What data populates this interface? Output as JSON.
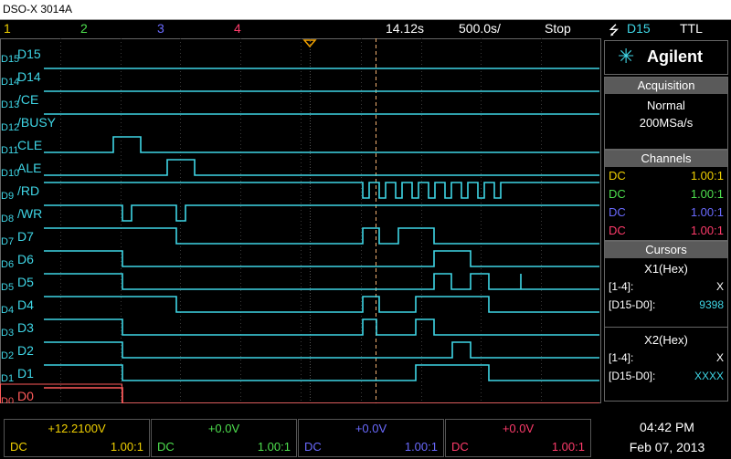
{
  "window": {
    "title": "DSO-X 3014A"
  },
  "topbar": {
    "ch1": "1",
    "ch2": "2",
    "ch3": "3",
    "ch4": "4",
    "time": "14.12s",
    "timebase": "500.0s/",
    "status": "Stop",
    "trigger_source": "D15",
    "logic": "TTL"
  },
  "colors": {
    "ch1": "#f0d000",
    "ch2": "#4ee04e",
    "ch3": "#6a6aff",
    "ch4": "#ff3b6b",
    "digital": "#3fd6e6",
    "d0": "#ff5a5a",
    "dark_bg": "#000000",
    "header_bg": "#5a5a5a"
  },
  "brand": {
    "name": "Agilent"
  },
  "acquisition": {
    "header": "Acquisition",
    "mode": "Normal",
    "rate": "200MSa/s"
  },
  "channels": {
    "header": "Channels",
    "rows": [
      {
        "coupling": "DC",
        "scale": "1.00:1"
      },
      {
        "coupling": "DC",
        "scale": "1.00:1"
      },
      {
        "coupling": "DC",
        "scale": "1.00:1"
      },
      {
        "coupling": "DC",
        "scale": "1.00:1"
      }
    ]
  },
  "cursors": {
    "header": "Cursors",
    "x1": {
      "title": "X1(Hex)",
      "row1_label": "[1-4]:",
      "row1_value": "X",
      "row2_label": "[D15-D0]:",
      "row2_value": "9398"
    },
    "x2": {
      "title": "X2(Hex)",
      "row1_label": "[1-4]:",
      "row1_value": "X",
      "row2_label": "[D15-D0]:",
      "row2_value": "XXXX"
    }
  },
  "bottom": {
    "ch": [
      {
        "value": "+12.2100V",
        "coupling": "DC",
        "scale": "1.00:1"
      },
      {
        "value": "+0.0V",
        "coupling": "DC",
        "scale": "1.00:1"
      },
      {
        "value": "+0.0V",
        "coupling": "DC",
        "scale": "1.00:1"
      },
      {
        "value": "+0.0V",
        "coupling": "DC",
        "scale": "1.00:1"
      }
    ],
    "time": "04:42 PM",
    "date": "Feb 07, 2013"
  },
  "traces": [
    {
      "id": "D15",
      "label": "D15",
      "level": "none"
    },
    {
      "id": "D14",
      "label": "D14",
      "level": "high"
    },
    {
      "id": "D13",
      "label": "/CE",
      "level": "high"
    },
    {
      "id": "D12",
      "label": "/BUSY",
      "level": "high"
    },
    {
      "id": "D11",
      "label": "CLE",
      "level": "low"
    },
    {
      "id": "D10",
      "label": "ALE",
      "level": "low"
    },
    {
      "id": "D9",
      "label": "/RD",
      "level": "high"
    },
    {
      "id": "D8",
      "label": "/WR",
      "level": "high"
    },
    {
      "id": "D7",
      "label": "D7",
      "level": "mixed"
    },
    {
      "id": "D6",
      "label": "D6",
      "level": "mixed"
    },
    {
      "id": "D5",
      "label": "D5",
      "level": "mixed"
    },
    {
      "id": "D4",
      "label": "D4",
      "level": "mixed"
    },
    {
      "id": "D3",
      "label": "D3",
      "level": "mixed"
    },
    {
      "id": "D2",
      "label": "D2",
      "level": "mixed"
    },
    {
      "id": "D1",
      "label": "D1",
      "level": "mixed"
    },
    {
      "id": "D0",
      "label": "D0",
      "level": "mixed"
    }
  ]
}
